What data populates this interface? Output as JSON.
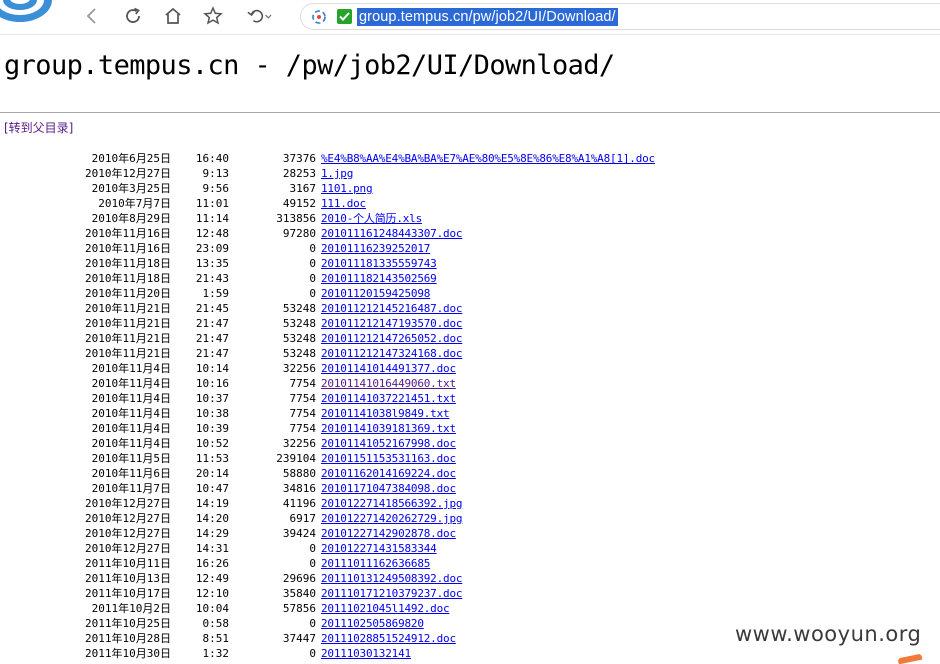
{
  "browser": {
    "url": "group.tempus.cn/pw/job2/UI/Download/",
    "icons": {
      "back": "chevron-left-icon",
      "reload": "reload-icon",
      "home": "home-icon",
      "favorite": "star-icon",
      "undo": "undo-icon",
      "secure": "secure-check-icon"
    }
  },
  "page": {
    "title": "group.tempus.cn - /pw/job2/UI/Download/",
    "parent_link": "[转到父目录]"
  },
  "listing": [
    {
      "date": "2010年6月25日",
      "time": "16:40",
      "size": "37376",
      "name": "%E4%B8%AA%E4%BA%BA%E7%AE%80%E5%8E%86%E8%A1%A8[1].doc"
    },
    {
      "date": "2010年12月27日",
      "time": "9:13",
      "size": "28253",
      "name": "1.jpg"
    },
    {
      "date": "2010年3月25日",
      "time": "9:56",
      "size": "3167",
      "name": "1101.png"
    },
    {
      "date": "2010年7月7日",
      "time": "11:01",
      "size": "49152",
      "name": "111.doc"
    },
    {
      "date": "2010年8月29日",
      "time": "11:14",
      "size": "313856",
      "name": "2010-个人简历.xls"
    },
    {
      "date": "2010年11月16日",
      "time": "12:48",
      "size": "97280",
      "name": "201011161248443307.doc"
    },
    {
      "date": "2010年11月16日",
      "time": "23:09",
      "size": "0",
      "name": "20101116239252017"
    },
    {
      "date": "2010年11月18日",
      "time": "13:35",
      "size": "0",
      "name": "201011181335559743"
    },
    {
      "date": "2010年11月18日",
      "time": "21:43",
      "size": "0",
      "name": "201011182143502569"
    },
    {
      "date": "2010年11月20日",
      "time": "1:59",
      "size": "0",
      "name": "20101120159425098"
    },
    {
      "date": "2010年11月21日",
      "time": "21:45",
      "size": "53248",
      "name": "201011212145216487.doc"
    },
    {
      "date": "2010年11月21日",
      "time": "21:47",
      "size": "53248",
      "name": "201011212147193570.doc"
    },
    {
      "date": "2010年11月21日",
      "time": "21:47",
      "size": "53248",
      "name": "201011212147265052.doc"
    },
    {
      "date": "2010年11月21日",
      "time": "21:47",
      "size": "53248",
      "name": "201011212147324168.doc"
    },
    {
      "date": "2010年11月4日",
      "time": "10:14",
      "size": "32256",
      "name": "20101141014491377.doc"
    },
    {
      "date": "2010年11月4日",
      "time": "10:16",
      "size": "7754",
      "name": "20101141016449060.txt",
      "visited": true
    },
    {
      "date": "2010年11月4日",
      "time": "10:37",
      "size": "7754",
      "name": "20101141037221451.txt"
    },
    {
      "date": "2010年11月4日",
      "time": "10:38",
      "size": "7754",
      "name": "20101141038l9849.txt"
    },
    {
      "date": "2010年11月4日",
      "time": "10:39",
      "size": "7754",
      "name": "20101141039181369.txt"
    },
    {
      "date": "2010年11月4日",
      "time": "10:52",
      "size": "32256",
      "name": "20101141052167998.doc"
    },
    {
      "date": "2010年11月5日",
      "time": "11:53",
      "size": "239104",
      "name": "20101151153531163.doc"
    },
    {
      "date": "2010年11月6日",
      "time": "20:14",
      "size": "58880",
      "name": "20101162014169224.doc"
    },
    {
      "date": "2010年11月7日",
      "time": "10:47",
      "size": "34816",
      "name": "20101171047384098.doc"
    },
    {
      "date": "2010年12月27日",
      "time": "14:19",
      "size": "41196",
      "name": "201012271418566392.jpg"
    },
    {
      "date": "2010年12月27日",
      "time": "14:20",
      "size": "6917",
      "name": "201012271420262729.jpg"
    },
    {
      "date": "2010年12月27日",
      "time": "14:29",
      "size": "39424",
      "name": "20101227142902878.doc"
    },
    {
      "date": "2010年12月27日",
      "time": "14:31",
      "size": "0",
      "name": "201012271431583344"
    },
    {
      "date": "2011年10月11日",
      "time": "16:26",
      "size": "0",
      "name": "20111011162636685"
    },
    {
      "date": "2011年10月13日",
      "time": "12:49",
      "size": "29696",
      "name": "201110131249508392.doc"
    },
    {
      "date": "2011年10月17日",
      "time": "12:10",
      "size": "35840",
      "name": "201110171210379237.doc"
    },
    {
      "date": "2011年10月2日",
      "time": "10:04",
      "size": "57856",
      "name": "20111021045l1492.doc"
    },
    {
      "date": "2011年10月25日",
      "time": "0:58",
      "size": "0",
      "name": "2011102505869820"
    },
    {
      "date": "2011年10月28日",
      "time": "8:51",
      "size": "37447",
      "name": "20111028851524912.doc"
    },
    {
      "date": "2011年10月30日",
      "time": "1:32",
      "size": "0",
      "name": "20111030132141"
    }
  ],
  "watermark": "www.wooyun.org"
}
